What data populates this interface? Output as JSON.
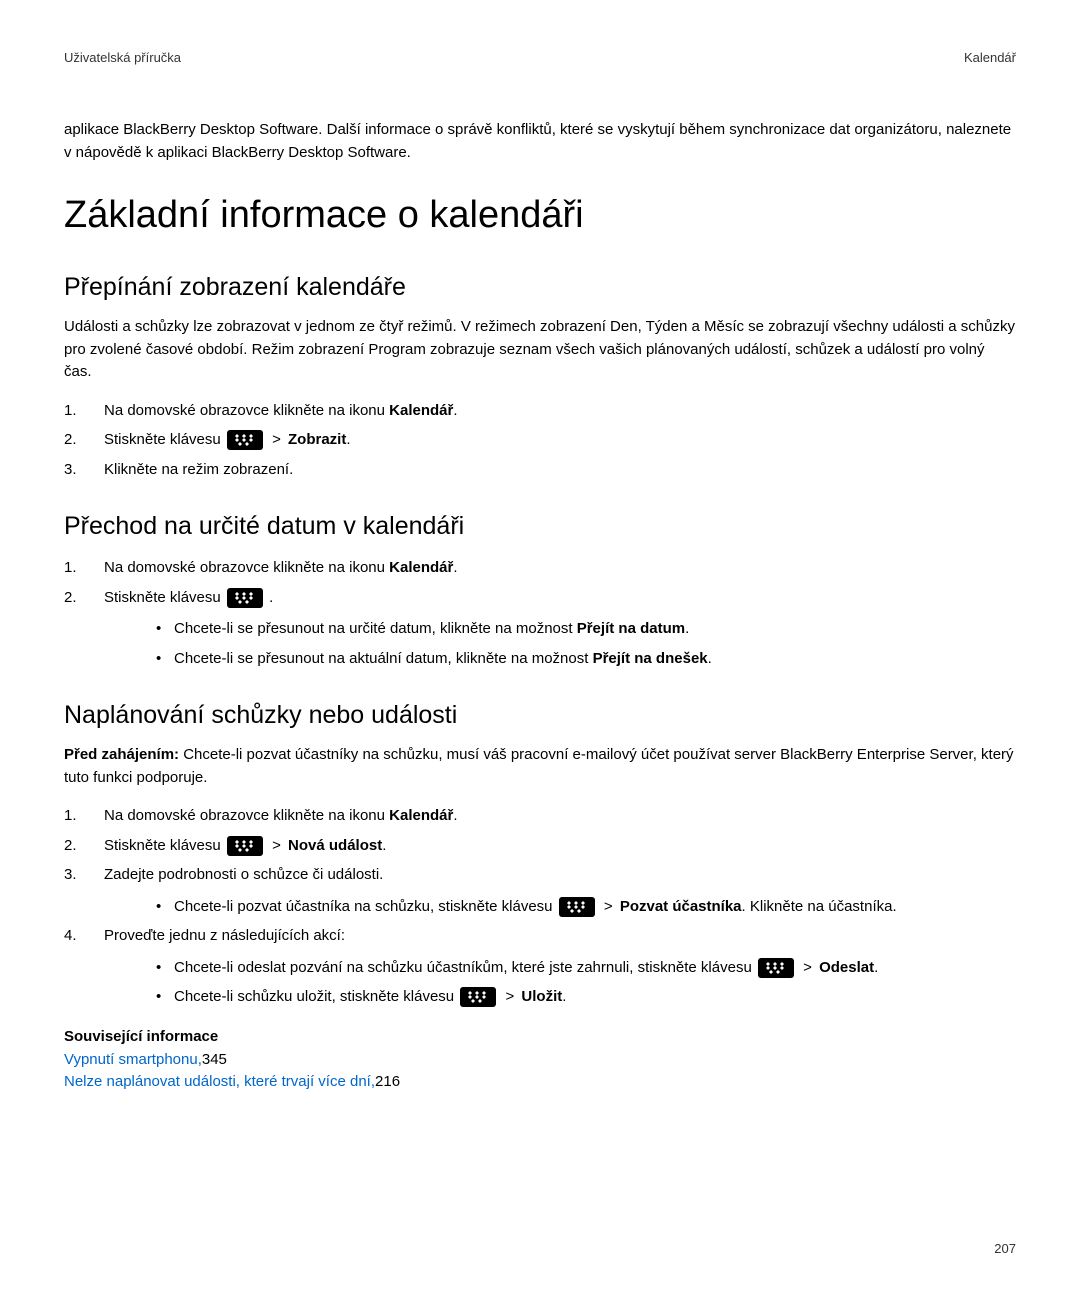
{
  "header": {
    "left": "Uživatelská příručka",
    "right": "Kalendář"
  },
  "intro": "aplikace BlackBerry Desktop Software. Další informace o správě konfliktů, které se vyskytují během synchronizace dat organizátoru, naleznete v nápovědě k aplikaci BlackBerry Desktop Software.",
  "h1": "Základní informace o kalendáři",
  "section1": {
    "title": "Přepínání zobrazení kalendáře",
    "para": "Události a schůzky lze zobrazovat v jednom ze čtyř režimů. V režimech zobrazení Den, Týden a Měsíc se zobrazují všechny události a schůzky pro zvolené časové období. Režim zobrazení Program zobrazuje seznam všech vašich plánovaných událostí, schůzek a událostí pro volný čas.",
    "step1_pre": "Na domovské obrazovce klikněte na ikonu ",
    "step1_bold": "Kalendář",
    "step2_pre": "Stiskněte klávesu ",
    "step2_bold": "Zobrazit",
    "step3": "Klikněte na režim zobrazení."
  },
  "section2": {
    "title": "Přechod na určité datum v kalendáři",
    "step1_pre": "Na domovské obrazovce klikněte na ikonu ",
    "step1_bold": "Kalendář",
    "step2_pre": "Stiskněte klávesu ",
    "bullet1_pre": "Chcete-li se přesunout na určité datum, klikněte na možnost ",
    "bullet1_bold": "Přejít na datum",
    "bullet2_pre": "Chcete-li se přesunout na aktuální datum, klikněte na možnost ",
    "bullet2_bold": "Přejít na dnešek"
  },
  "section3": {
    "title": "Naplánování schůzky nebo události",
    "para_bold": "Před zahájením: ",
    "para_rest": "Chcete-li pozvat účastníky na schůzku, musí váš pracovní e-mailový účet používat server BlackBerry Enterprise Server, který tuto funkci podporuje.",
    "step1_pre": "Na domovské obrazovce klikněte na ikonu ",
    "step1_bold": "Kalendář",
    "step2_pre": "Stiskněte klávesu ",
    "step2_bold": "Nová událost",
    "step3": "Zadejte podrobnosti o schůzce či události.",
    "step3_bullet_pre": "Chcete-li pozvat účastníka na schůzku, stiskněte klávesu ",
    "step3_bullet_bold": "Pozvat účastníka",
    "step3_bullet_post": ". Klikněte na účastníka.",
    "step4": "Proveďte jednu z následujících akcí:",
    "step4_b1_pre": "Chcete-li odeslat pozvání na schůzku účastníkům, které jste zahrnuli, stiskněte klávesu ",
    "step4_b1_bold": "Odeslat",
    "step4_b2_pre": "Chcete-li schůzku uložit, stiskněte klávesu ",
    "step4_b2_bold": "Uložit"
  },
  "related": {
    "heading": "Související informace",
    "link1_text": "Vypnutí smartphonu,",
    "link1_page": "345",
    "link2_text": "Nelze naplánovat události, které trvají více dní,",
    "link2_page": "216"
  },
  "page_number": "207",
  "gt": ">"
}
